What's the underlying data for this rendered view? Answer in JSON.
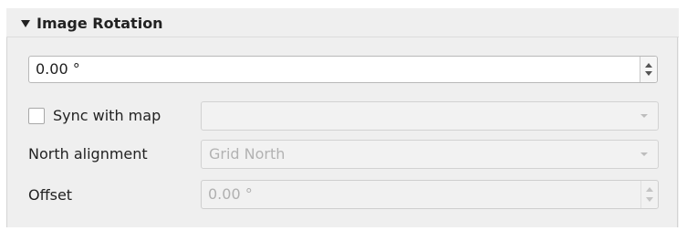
{
  "section": {
    "title": "Image Rotation",
    "expanded": true
  },
  "rotation": {
    "value": "0.00 °"
  },
  "sync": {
    "label": "Sync with map",
    "checked": false,
    "selected": ""
  },
  "north_alignment": {
    "label": "North alignment",
    "selected": "Grid North"
  },
  "offset": {
    "label": "Offset",
    "value": "0.00 °"
  },
  "icons": {
    "collapse": "triangle-down-icon",
    "spin": "up-down-arrows-icon",
    "dropdown": "chevron-down-icon"
  }
}
